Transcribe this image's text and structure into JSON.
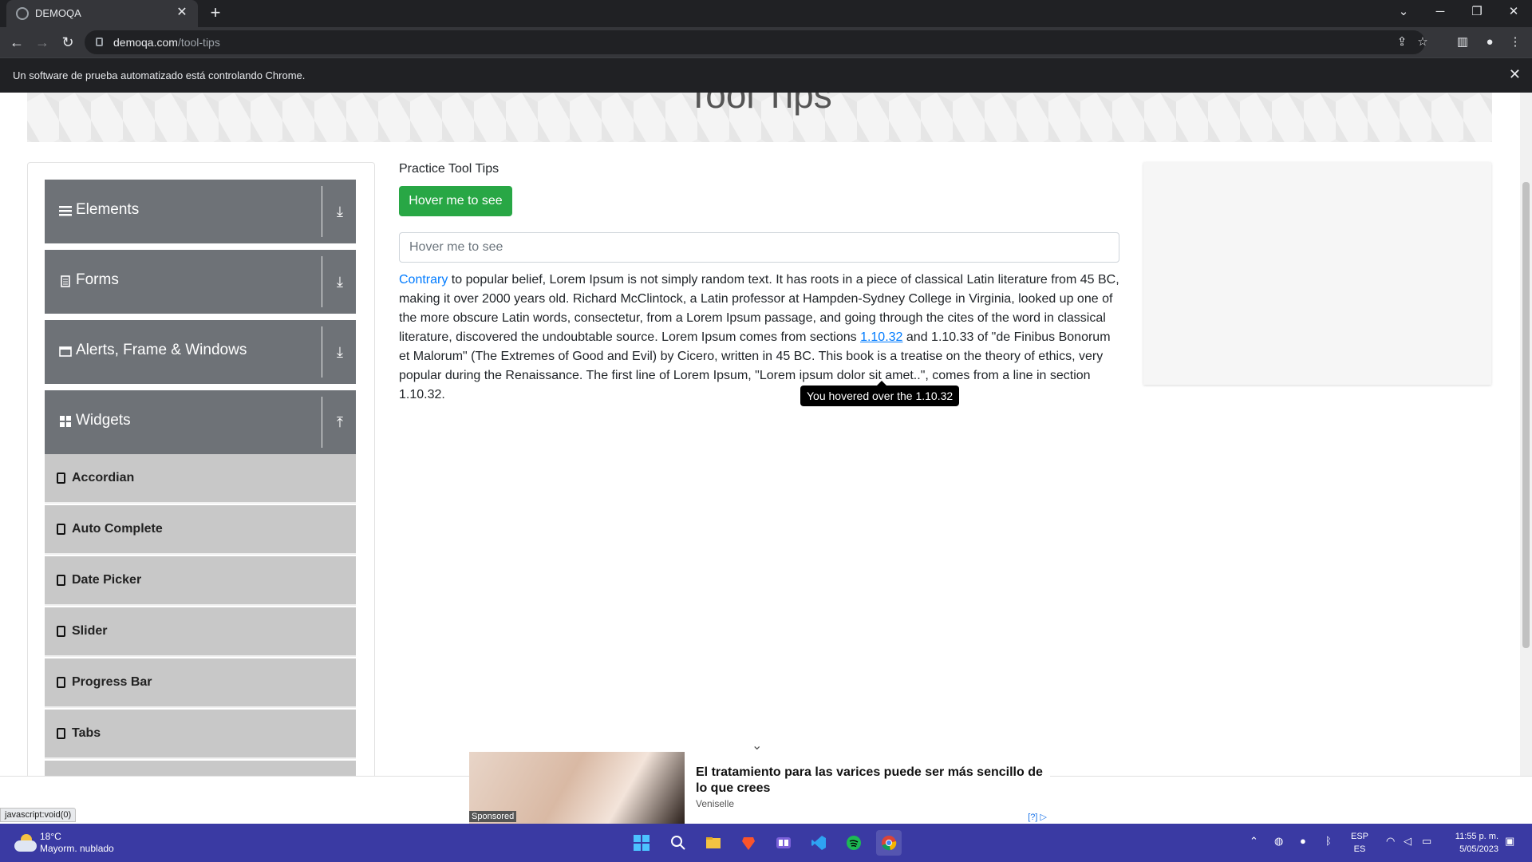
{
  "browser": {
    "tab_title": "DEMOQA",
    "url_host": "demoqa.com",
    "url_path": "/tool-tips",
    "infobar_message": "Un software de prueba automatizado está controlando Chrome."
  },
  "page": {
    "heading": "Tool Tips",
    "practice_title": "Practice Tool Tips",
    "hover_button": "Hover me to see",
    "hover_field_placeholder": "Hover me to see",
    "paragraph": {
      "link1": "Contrary",
      "part1": " to popular belief, Lorem Ipsum is not simply random text. It has roots in a piece of classical Latin literature from 45 BC, making it over 2000 years old. Richard McClintock, a Latin professor at Hampden-Sydney College in Virginia, looked up one of the more obscure Latin words, consectetur, from a Lorem Ipsum passage, and going through the cites of the word in classical literature, discovered the undoubtable source. Lorem Ipsum comes from sections ",
      "link2": "1.10.32",
      "part2": " and 1.10.33 of \"de Finibus Bonorum et Malorum\" (The Extremes of Good and Evil) by Cicero, written in 45 BC. This book is a treatise on the theory of ethics, very popular during the Renaissance. The first line of Lorem Ipsum, \"Lorem ipsum dolor sit amet..\", comes from a line in section 1.10.32."
    },
    "tooltip": "You hovered over the 1.10.32"
  },
  "sidebar": {
    "groups": [
      {
        "label": "Elements",
        "icon": "hamburger-icon",
        "arrow": "download-arrow-icon"
      },
      {
        "label": "Forms",
        "icon": "document-icon",
        "arrow": "download-arrow-icon"
      },
      {
        "label": "Alerts, Frame & Windows",
        "icon": "window-icon",
        "arrow": "download-arrow-icon"
      },
      {
        "label": "Widgets",
        "icon": "grid-icon",
        "arrow": "upload-arrow-icon"
      }
    ],
    "widget_items": [
      "Accordian",
      "Auto Complete",
      "Date Picker",
      "Slider",
      "Progress Bar",
      "Tabs"
    ]
  },
  "ad": {
    "headline": "El tratamiento para las varices puede ser más sencillo de lo que crees",
    "brand": "Veniselle",
    "sponsored": "Sponsored",
    "adchoice": "[?]"
  },
  "status_url": "javascript:void(0)",
  "taskbar": {
    "temperature": "18°C",
    "weather": "Mayorm. nublado",
    "lang_top": "ESP",
    "lang_bottom": "ES",
    "time": "11:55 p. m.",
    "date": "5/05/2023"
  },
  "colors": {
    "accent_green": "#28a745",
    "sidebar_group": "#6e7277",
    "sidebar_item": "#c8c8c8",
    "link_blue": "#007bff",
    "taskbar": "#3a3aa3"
  }
}
